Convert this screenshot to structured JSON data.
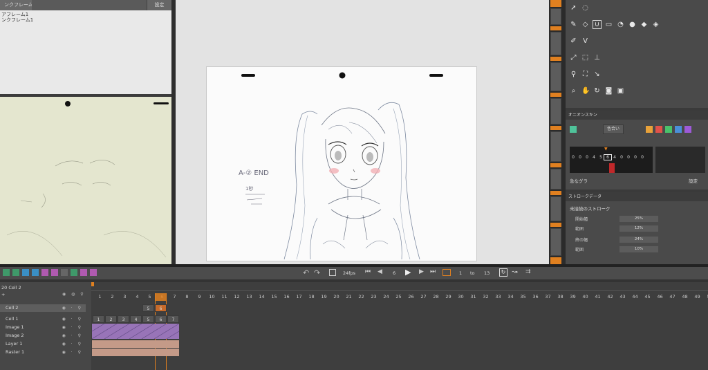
{
  "left_panel": {
    "tab_title": "ンクフレーム",
    "settings_label": "設定",
    "list_items": [
      "アフレーム1",
      "ンクフレーム1"
    ]
  },
  "canvas": {
    "sketch_note1": "A-② END",
    "sketch_note2": "1秒"
  },
  "onion_skin": {
    "title": "オニオンスキン",
    "mode_label": "色合い",
    "frame_numbers": [
      "0",
      "0",
      "0",
      "4",
      "5",
      "6",
      "4",
      "0",
      "0",
      "0",
      "0"
    ],
    "blend_label": "急なグラ",
    "settings_label": "設定",
    "color_left": "#4fc39a",
    "colors_right": [
      "#e8a23a",
      "#e0524a",
      "#49c26b",
      "#4a8fd8",
      "#9d5ad8"
    ]
  },
  "stroke": {
    "title": "ストロークデータ",
    "subtitle": "未接続のストローク",
    "rows": [
      {
        "label": "開始幅",
        "value": "25%"
      },
      {
        "label": "範囲",
        "value": "12%"
      },
      {
        "label": "終の幅",
        "value": "24%"
      },
      {
        "label": "範囲",
        "value": "10%"
      }
    ]
  },
  "toolbar": {
    "fps": "24fps",
    "current_frame": "6",
    "range_start": "1",
    "range_to": "to",
    "range_end": "13"
  },
  "timeline": {
    "header": "20 Cell 2",
    "layers": [
      "Cell 2",
      "Cell 1",
      "Image 1",
      "Image 2",
      "Layer 1",
      "Raster 1"
    ],
    "frames": [
      "1",
      "2",
      "3",
      "4",
      "5",
      "6",
      "7",
      "8",
      "9",
      "10",
      "11",
      "12",
      "13",
      "14",
      "15",
      "16",
      "17",
      "18",
      "19",
      "20",
      "21",
      "22",
      "23",
      "24",
      "25",
      "26",
      "27",
      "28",
      "29",
      "30",
      "31",
      "32",
      "33",
      "34",
      "35",
      "36",
      "37",
      "38",
      "39",
      "40",
      "41",
      "42",
      "43",
      "44",
      "45",
      "46",
      "47",
      "48",
      "49",
      "50"
    ],
    "cell2_marks": [
      "5",
      "6"
    ],
    "cell1_marks": [
      "1",
      "2",
      "3",
      "4",
      "5",
      "6",
      "7"
    ]
  }
}
